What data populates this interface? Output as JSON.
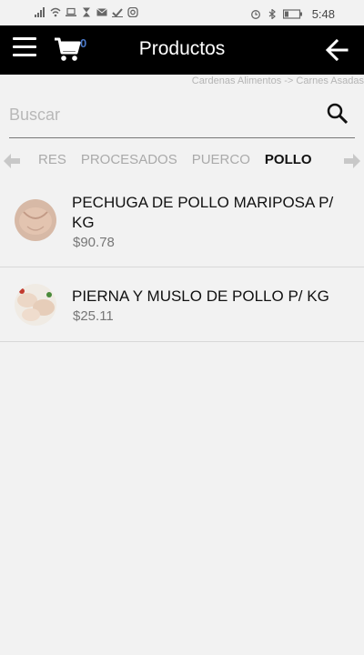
{
  "status_bar": {
    "time": "5:48",
    "left_icons": [
      "signal-icon",
      "wifi-icon",
      "laptop-icon",
      "hourglass-icon",
      "mail-icon",
      "check-icon",
      "instagram-icon"
    ],
    "right_icons": [
      "alarm-icon",
      "bluetooth-icon",
      "battery-icon"
    ]
  },
  "appbar": {
    "title": "Productos",
    "cart_count": "0",
    "background": "#000000"
  },
  "breadcrumb": "Cardenas Alimentos -> Carnes Asadas",
  "search": {
    "placeholder": "Buscar",
    "value": ""
  },
  "tabs": [
    {
      "label": "RES",
      "active": false
    },
    {
      "label": "PROCESADOS",
      "active": false
    },
    {
      "label": "PUERCO",
      "active": false
    },
    {
      "label": "POLLO",
      "active": true
    }
  ],
  "products": [
    {
      "name": "PECHUGA DE POLLO MARIPOSA P/ KG",
      "price": "$90.78"
    },
    {
      "name": "PIERNA Y MUSLO DE POLLO P/ KG",
      "price": "$25.11"
    }
  ]
}
